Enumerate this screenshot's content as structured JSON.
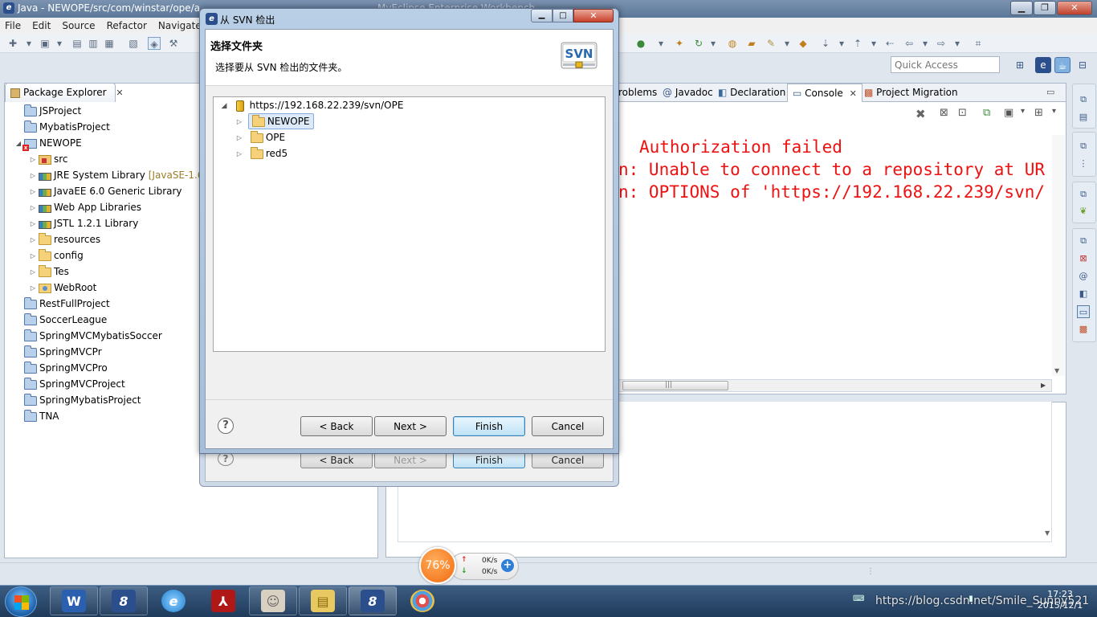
{
  "window": {
    "title": "Java - NEWOPE/src/com/winstar/ope/a",
    "title_tail": "MyEclipse Enterprise Workbench"
  },
  "menu": [
    "File",
    "Edit",
    "Source",
    "Refactor",
    "Navigate"
  ],
  "quick_access": {
    "placeholder": "Quick Access"
  },
  "package_explorer": {
    "tab_label": "Package Explorer",
    "items": [
      {
        "label": "JSProject",
        "icon": "project-icon",
        "indent": 0,
        "twisty": ""
      },
      {
        "label": "MybatisProject",
        "icon": "project-icon",
        "indent": 0,
        "twisty": ""
      },
      {
        "label": "NEWOPE",
        "icon": "project-error-icon",
        "indent": 0,
        "twisty": "◢"
      },
      {
        "label": "src",
        "icon": "source-folder-icon",
        "indent": 1,
        "twisty": "▷"
      },
      {
        "label": "JRE System Library",
        "deco": "[JavaSE-1.6",
        "icon": "library-icon",
        "indent": 1,
        "twisty": "▷"
      },
      {
        "label": "JavaEE 6.0 Generic Library",
        "icon": "library-icon",
        "indent": 1,
        "twisty": "▷"
      },
      {
        "label": "Web App Libraries",
        "icon": "library-icon",
        "indent": 1,
        "twisty": "▷"
      },
      {
        "label": "JSTL 1.2.1 Library",
        "icon": "library-icon",
        "indent": 1,
        "twisty": "▷"
      },
      {
        "label": "resources",
        "icon": "folder-icon",
        "indent": 1,
        "twisty": "▷"
      },
      {
        "label": "config",
        "icon": "folder-icon",
        "indent": 1,
        "twisty": "▷"
      },
      {
        "label": "Tes",
        "icon": "folder-icon",
        "indent": 1,
        "twisty": "▷"
      },
      {
        "label": "WebRoot",
        "icon": "webroot-folder-icon",
        "indent": 1,
        "twisty": "▷"
      },
      {
        "label": "RestFullProject",
        "icon": "project-icon",
        "indent": 0,
        "twisty": ""
      },
      {
        "label": "SoccerLeague",
        "icon": "project-icon",
        "indent": 0,
        "twisty": ""
      },
      {
        "label": "SpringMVCMybatisSoccer",
        "icon": "project-icon",
        "indent": 0,
        "twisty": ""
      },
      {
        "label": "SpringMVCPr",
        "icon": "project-icon",
        "indent": 0,
        "twisty": ""
      },
      {
        "label": "SpringMVCPro",
        "icon": "project-icon",
        "indent": 0,
        "twisty": ""
      },
      {
        "label": "SpringMVCProject",
        "icon": "project-icon",
        "indent": 0,
        "twisty": ""
      },
      {
        "label": "SpringMybatisProject",
        "icon": "project-icon",
        "indent": 0,
        "twisty": ""
      },
      {
        "label": "TNA",
        "icon": "project-icon",
        "indent": 0,
        "twisty": ""
      }
    ]
  },
  "views": {
    "tabs": [
      {
        "label": "roblems",
        "icon": "problems-icon"
      },
      {
        "label": "Javadoc",
        "icon": "at-icon",
        "glyph": "@"
      },
      {
        "label": "Declaration",
        "icon": "declaration-icon"
      },
      {
        "label": "Console",
        "icon": "console-icon",
        "active": true
      },
      {
        "label": "Project Migration",
        "icon": "migration-icon"
      }
    ]
  },
  "console": {
    "lines": [
      "Authorization failed",
      "n: Unable to connect to a repository at UR",
      "n: OPTIONS of 'https://192.168.22.239/svn/"
    ],
    "text_color": "#ee1111"
  },
  "dialog": {
    "title": "从 SVN 检出",
    "header_title": "选择文件夹",
    "header_desc": "选择要从 SVN 检出的文件夹。",
    "logo_text": "SVN",
    "tree": {
      "root": "https://192.168.22.239/svn/OPE",
      "children": [
        "NEWOPE",
        "OPE",
        "red5"
      ],
      "selected": "NEWOPE"
    },
    "buttons": {
      "back": "< Back",
      "next": "Next >",
      "finish": "Finish",
      "cancel": "Cancel"
    }
  },
  "ghost_buttons": {
    "back": "< Back",
    "next": "Next >",
    "finish": "Finish",
    "cancel": "Cancel"
  },
  "speed_widget": {
    "percent": "76%",
    "up": "0K/s",
    "down": "0K/s"
  },
  "taskbar": {
    "apps": [
      "word-icon",
      "myeclipse-icon",
      "ie-icon",
      "acrobat-icon",
      "mascot-icon",
      "explorer-icon",
      "myeclipse-icon",
      "paint-icon"
    ],
    "clock_time": "17:23",
    "clock_date": "2015/12/1"
  },
  "watermark": "https://blog.csdn.net/Smile_Sunny521"
}
